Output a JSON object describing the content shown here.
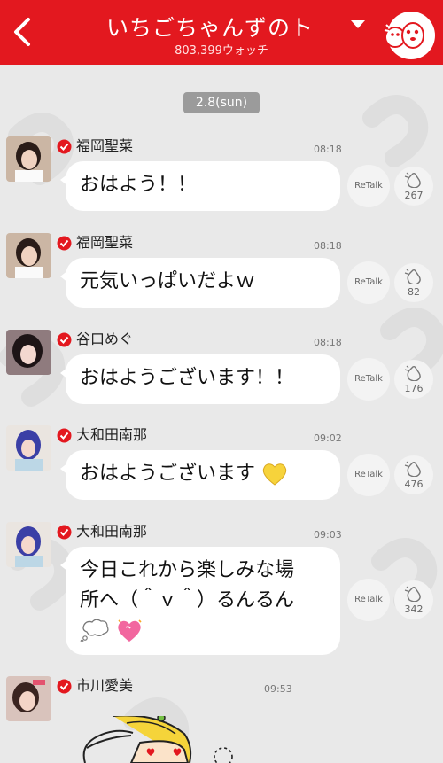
{
  "header": {
    "title": "いちごちゃんずのト",
    "watch_count": "803,399ウォッチ",
    "colors": {
      "bar": "#e3181f",
      "text": "#ffffff"
    }
  },
  "date_label": "2.8(sun)",
  "retalk_label": "ReTalk",
  "messages": [
    {
      "name": "福岡聖菜",
      "time": "08:18",
      "text": "おはよう！！",
      "claps": "267",
      "avatar": "avatar-photo"
    },
    {
      "name": "福岡聖菜",
      "time": "08:18",
      "text": "元気いっぱいだよｗ",
      "claps": "82",
      "avatar": "avatar-photo"
    },
    {
      "name": "谷口めぐ",
      "time": "08:18",
      "text": "おはようございます！！",
      "claps": "176",
      "avatar": "avatar-photo"
    },
    {
      "name": "大和田南那",
      "time": "09:02",
      "text": "おはようございます",
      "claps": "476",
      "avatar": "avatar-photo",
      "emoji": "yellow-heart-icon"
    },
    {
      "name": "大和田南那",
      "time": "09:03",
      "line1": "今日これから楽しみな場",
      "line2": "所へ（＾ｖ＾）るんるん",
      "claps": "342",
      "avatar": "avatar-photo",
      "emoji": [
        "thought-bubble-icon",
        "sparkling-heart-icon"
      ]
    },
    {
      "name": "市川愛美",
      "time": "09:53",
      "avatar": "avatar-photo",
      "content": "illustration-sticker"
    }
  ]
}
